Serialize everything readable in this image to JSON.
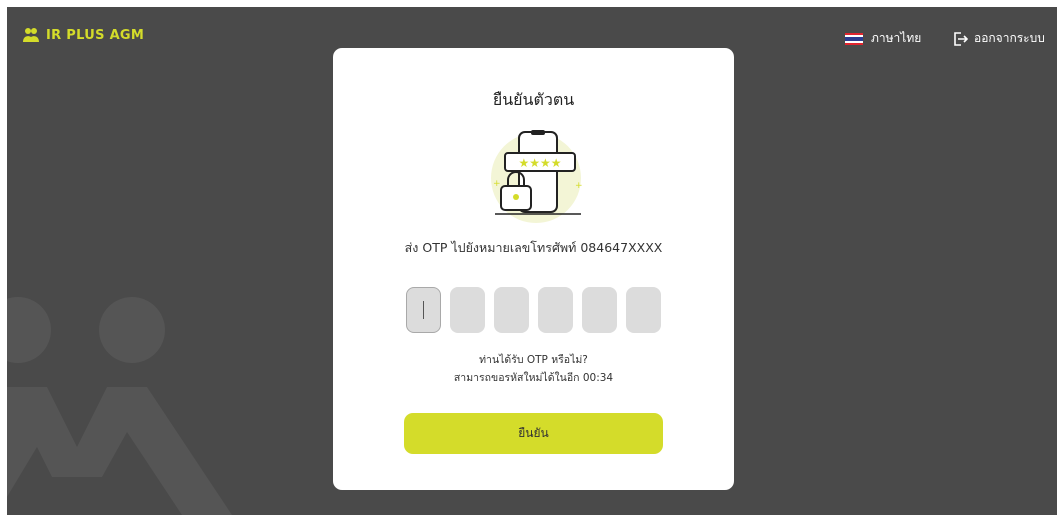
{
  "header": {
    "logo_text": "IR PLUS AGM",
    "language_label": "ภาษาไทย",
    "logout_label": "ออกจากระบบ"
  },
  "card": {
    "title": "ยืนยันตัวตน",
    "otp_message": "ส่ง OTP ไปยังหมายเลขโทรศัพท์ 084647XXXX",
    "otp_digits": [
      "",
      "",
      "",
      "",
      "",
      ""
    ],
    "resend_question": "ท่านได้รับ OTP หรือไม่?",
    "resend_timer": "สามารถขอรหัสใหม่ได้ในอีก 00:34",
    "confirm_label": "ยืนยัน",
    "illustration_stars": "★★★★"
  },
  "colors": {
    "background": "#4a4a4a",
    "accent": "#d4dc2a",
    "card": "#ffffff",
    "otp_box": "#dcdcdc"
  }
}
